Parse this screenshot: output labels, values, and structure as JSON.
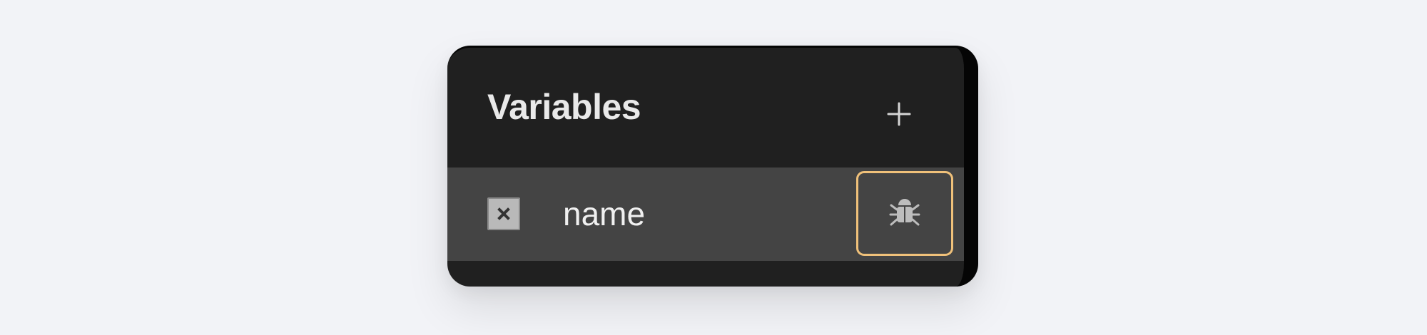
{
  "panel": {
    "title": "Variables",
    "add_icon": "plus-icon",
    "rows": [
      {
        "label": "name",
        "type_icon": "close-box-icon",
        "action_icon": "bug-icon"
      }
    ]
  },
  "colors": {
    "page_background": "#f2f3f7",
    "panel_background": "#202020",
    "row_background": "#444444",
    "focus_outline": "#f0c17a",
    "text_primary": "#e9e9e9"
  }
}
